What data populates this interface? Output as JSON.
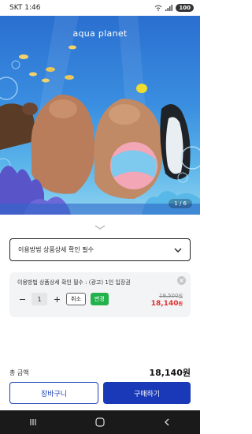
{
  "status_bar": {
    "carrier_time": "SKT 1:46",
    "battery": "100"
  },
  "hero": {
    "logo_text": "aqua planet",
    "counter": "1 / 6"
  },
  "option_select": {
    "label": "이용방법 상품상세 확인 필수"
  },
  "selected_option": {
    "title": "이용방법 상품상세 확인 필수 : (광고) 1인 입장권",
    "quantity": "1",
    "cancel_label": "취소",
    "change_label": "변경",
    "original_price": "19,500",
    "sale_price": "18,140",
    "currency": "원"
  },
  "summary": {
    "total_label": "총 금액",
    "total_amount": "18,140원"
  },
  "actions": {
    "cart_label": "장바구니",
    "buy_label": "구매하기"
  },
  "icons": {
    "signal": "signal-icon",
    "wifi": "wifi-icon",
    "chevron": "chevron-down-icon",
    "close": "close-icon",
    "minus": "minus-icon",
    "plus": "plus-icon",
    "recent": "recent-apps-icon",
    "home": "home-icon",
    "back": "back-icon"
  },
  "colors": {
    "accent": "#1a39b8",
    "sale": "#e0302f",
    "change": "#22b24c"
  }
}
